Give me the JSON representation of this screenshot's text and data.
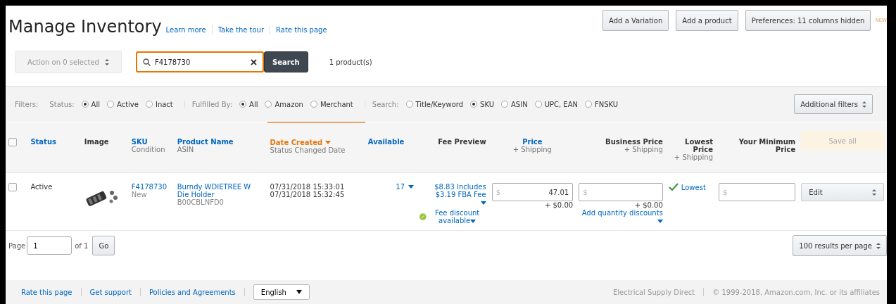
{
  "header": {
    "title": "Manage Inventory",
    "links": [
      "Learn more",
      "Take the tour",
      "Rate this page"
    ],
    "buttons": [
      "Add a Variation",
      "Add a product",
      "Preferences: 11 columns hidden"
    ],
    "badge": "NEW"
  },
  "toolbar": {
    "action_select": "Action on 0 selected",
    "search_value": "F4178730",
    "search_button": "Search",
    "result_count": "1 product(s)"
  },
  "filters": {
    "label": "Filters:",
    "groups": [
      {
        "label": "Status:",
        "options": [
          {
            "label": "All",
            "selected": true
          },
          {
            "label": "Active",
            "selected": false
          },
          {
            "label": "Inact",
            "selected": false
          }
        ]
      },
      {
        "label": "Fulfilled By:",
        "options": [
          {
            "label": "All",
            "selected": true
          },
          {
            "label": "Amazon",
            "selected": false
          },
          {
            "label": "Merchant",
            "selected": false
          }
        ]
      },
      {
        "label": "Search:",
        "options": [
          {
            "label": "Title/Keyword",
            "selected": false
          },
          {
            "label": "SKU",
            "selected": true
          },
          {
            "label": "ASIN",
            "selected": false
          },
          {
            "label": "UPC, EAN",
            "selected": false
          },
          {
            "label": "FNSKU",
            "selected": false
          }
        ]
      }
    ],
    "additional": "Additional filters"
  },
  "table": {
    "select_all_checked": false,
    "columns": [
      {
        "kind": "check"
      },
      {
        "kind": "link",
        "title": "Status"
      },
      {
        "kind": "plain",
        "title": "Image"
      },
      {
        "kind": "link",
        "title": "SKU",
        "subtitle": "Condition"
      },
      {
        "kind": "link",
        "title": "Product Name",
        "subtitle": "ASIN"
      },
      {
        "kind": "sorted",
        "title": "Date Created",
        "subtitle": "Status Changed Date"
      },
      {
        "kind": "link",
        "title": "Available"
      },
      {
        "kind": "plain",
        "title": "Fee Preview"
      },
      {
        "kind": "link",
        "title": "Price",
        "subtitle": "+ Shipping"
      },
      {
        "kind": "plain",
        "title": "Business Price",
        "subtitle": "+ Shipping"
      },
      {
        "kind": "plain",
        "title": "Lowest Price",
        "subtitle": "+ Shipping"
      },
      {
        "kind": "plain",
        "title": "Your Minimum Price"
      },
      {
        "kind": "save",
        "title": "Save all"
      }
    ],
    "rows": [
      {
        "checked": false,
        "status": "Active",
        "sku": "F4178730",
        "condition": "New",
        "product_name": "Burndy WDIETREE W Die Holder",
        "asin": "B00CBLNFD0",
        "date_created": "07/31/2018 15:33:01",
        "status_changed": "07/31/2018 15:32:45",
        "available": "17",
        "fee_preview": "$8.83 Includes $3.19 FBA Fee",
        "fee_discount": "Fee discount available",
        "price_currency": "$",
        "price": "47.01",
        "price_shipping": "+ $0.00",
        "business_currency": "$",
        "business_shipping": "+ $0.00",
        "quantity_discounts": "Add quantity discounts",
        "lowest": "Lowest",
        "lowest_ok": true,
        "min_currency": "$",
        "action": "Edit"
      }
    ]
  },
  "pagination": {
    "label": "Page",
    "page": "1",
    "of": "of 1",
    "go": "Go",
    "per_page": "100 results per page"
  },
  "footer": {
    "links": [
      "Rate this page",
      "Get support",
      "Policies and Agreements"
    ],
    "language": "English",
    "right": [
      "Electrical Supply Direct",
      "© 1999-2018, Amazon.com, Inc. or its affiliates"
    ]
  }
}
